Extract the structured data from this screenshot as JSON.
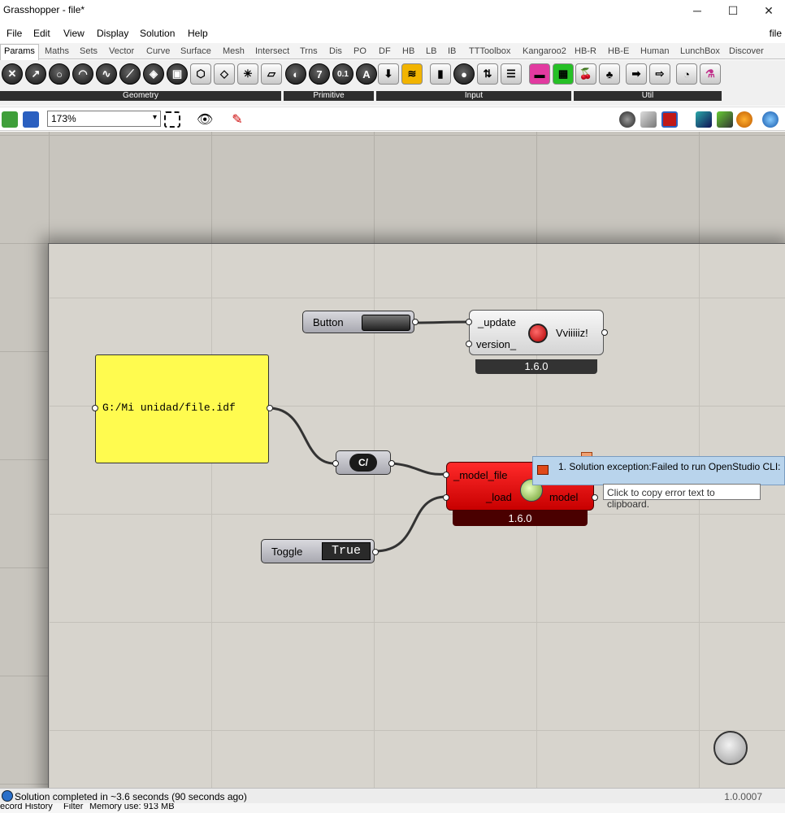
{
  "window": {
    "title": "Grasshopper - file*",
    "minimize": "─",
    "maximize": "☐",
    "close": "✕"
  },
  "menu": {
    "items": [
      "File",
      "Edit",
      "View",
      "Display",
      "Solution",
      "Help"
    ],
    "right": "file"
  },
  "tabs": [
    "Params",
    "Maths",
    "Sets",
    "Vector",
    "Curve",
    "Surface",
    "Mesh",
    "Intersect",
    "Trns",
    "Dis",
    "PO",
    "DF",
    "HB",
    "LB",
    "IB",
    "TTToolbox",
    "Kangaroo2",
    "HB-R",
    "HB-E",
    "Human",
    "LunchBox",
    "Discover"
  ],
  "ribbon": {
    "groups": [
      "Geometry",
      "Primitive",
      "Input",
      "Util"
    ],
    "primitive_glyphs": [
      "0",
      "7",
      "0.1",
      "A"
    ]
  },
  "toolbar": {
    "zoom": "173%"
  },
  "canvas": {
    "button": {
      "label": "Button"
    },
    "version": {
      "in1": "_update",
      "in2": "version_",
      "out": "Vviiiiiz!",
      "footer": "1.6.0"
    },
    "panel": {
      "text": "G:/Mi unidad/file.idf"
    },
    "path": {
      "label": "C/"
    },
    "load": {
      "in1": "_model_file",
      "in2": "_load",
      "out": "model",
      "footer": "1.6.0"
    },
    "toggle": {
      "label": "Toggle",
      "value": "True"
    },
    "error": {
      "message": "1. Solution exception:Failed to run OpenStudio CLI:",
      "tooltip": "Click to copy error text to clipboard."
    }
  },
  "status": {
    "message": "Solution completed in ~3.6 seconds (90 seconds ago)",
    "version": "1.0.0007",
    "bottom_items": [
      "ecord History",
      "Filter",
      "Memory use: 913 MB"
    ]
  }
}
